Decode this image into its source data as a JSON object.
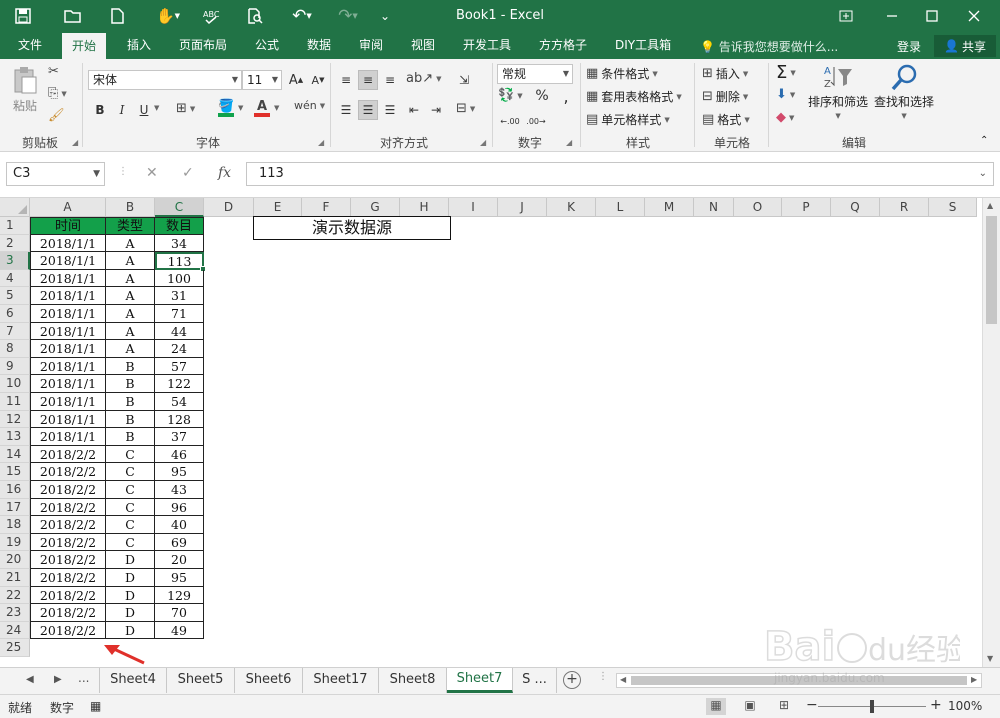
{
  "window": {
    "title": "Book1 - Excel"
  },
  "quick_access": [
    {
      "name": "save-icon",
      "glyph": "💾"
    },
    {
      "name": "open-icon",
      "glyph": "📂"
    },
    {
      "name": "new-icon",
      "glyph": "🗋"
    },
    {
      "name": "touch-mode-icon",
      "glyph": "✋"
    },
    {
      "name": "spellcheck-icon",
      "glyph": "✓"
    },
    {
      "name": "print-preview-icon",
      "glyph": "🔍"
    },
    {
      "name": "undo-icon",
      "glyph": "↶"
    },
    {
      "name": "redo-icon",
      "glyph": "↷"
    },
    {
      "name": "customize-qat-icon",
      "glyph": "⌄"
    }
  ],
  "tabs": [
    {
      "label": "文件"
    },
    {
      "label": "开始"
    },
    {
      "label": "插入"
    },
    {
      "label": "页面布局"
    },
    {
      "label": "公式"
    },
    {
      "label": "数据"
    },
    {
      "label": "审阅"
    },
    {
      "label": "视图"
    },
    {
      "label": "开发工具"
    },
    {
      "label": "方方格子"
    },
    {
      "label": "DIY工具箱"
    }
  ],
  "active_tab": "开始",
  "tell_me": "告诉我您想要做什么...",
  "login": "登录",
  "share": "共享",
  "ribbon": {
    "clipboard": {
      "label": "剪贴板",
      "paste": "粘贴"
    },
    "font": {
      "label": "字体",
      "font_name": "宋体",
      "font_size": "11"
    },
    "alignment": {
      "label": "对齐方式"
    },
    "number": {
      "label": "数字",
      "format": "常规"
    },
    "styles": {
      "label": "样式",
      "conditional": "条件格式",
      "table": "套用表格格式",
      "cell_styles": "单元格样式"
    },
    "cells": {
      "label": "单元格",
      "insert": "插入",
      "delete": "删除",
      "format": "格式"
    },
    "editing": {
      "label": "编辑",
      "sort_filter": "排序和筛选",
      "find_select": "查找和选择"
    }
  },
  "formula_bar": {
    "name_box": "C3",
    "value": "113",
    "fx": "fx"
  },
  "columns": [
    "A",
    "B",
    "C",
    "D",
    "E",
    "F",
    "G",
    "H",
    "I",
    "J",
    "K",
    "L",
    "M",
    "N",
    "O",
    "P",
    "Q",
    "R",
    "S"
  ],
  "selected_column": "C",
  "selected_row": 3,
  "table": {
    "headers": [
      "时间",
      "类型",
      "数目"
    ],
    "rows": [
      [
        "2018/1/1",
        "A",
        "34"
      ],
      [
        "2018/1/1",
        "A",
        "113"
      ],
      [
        "2018/1/1",
        "A",
        "100"
      ],
      [
        "2018/1/1",
        "A",
        "31"
      ],
      [
        "2018/1/1",
        "A",
        "71"
      ],
      [
        "2018/1/1",
        "A",
        "44"
      ],
      [
        "2018/1/1",
        "A",
        "24"
      ],
      [
        "2018/1/1",
        "B",
        "57"
      ],
      [
        "2018/1/1",
        "B",
        "122"
      ],
      [
        "2018/1/1",
        "B",
        "54"
      ],
      [
        "2018/1/1",
        "B",
        "128"
      ],
      [
        "2018/1/1",
        "B",
        "37"
      ],
      [
        "2018/2/2",
        "C",
        "46"
      ],
      [
        "2018/2/2",
        "C",
        "95"
      ],
      [
        "2018/2/2",
        "C",
        "43"
      ],
      [
        "2018/2/2",
        "C",
        "96"
      ],
      [
        "2018/2/2",
        "C",
        "40"
      ],
      [
        "2018/2/2",
        "C",
        "69"
      ],
      [
        "2018/2/2",
        "D",
        "20"
      ],
      [
        "2018/2/2",
        "D",
        "95"
      ],
      [
        "2018/2/2",
        "D",
        "129"
      ],
      [
        "2018/2/2",
        "D",
        "70"
      ],
      [
        "2018/2/2",
        "D",
        "49"
      ]
    ],
    "header_color": "#13a04a"
  },
  "demo_label": "演示数据源",
  "row_numbers": [
    "1",
    "2",
    "3",
    "4",
    "5",
    "6",
    "7",
    "8",
    "9",
    "10",
    "11",
    "12",
    "13",
    "14",
    "15",
    "16",
    "17",
    "18",
    "19",
    "20",
    "21",
    "22",
    "23",
    "24",
    "25"
  ],
  "sheets": {
    "ellipsis_left": "...",
    "tabs": [
      "Sheet4",
      "Sheet5",
      "Sheet6",
      "Sheet17",
      "Sheet8",
      "Sheet7",
      "S ..."
    ],
    "active": "Sheet7"
  },
  "status": {
    "ready": "就绪",
    "num": "数字",
    "zoom": "100%",
    "minus": "−",
    "plus": "+"
  },
  "watermark": {
    "text": "Baidu经验",
    "url_text": "jingyan.baidu.com"
  },
  "colors": {
    "excel_green": "#217346",
    "arrow_red": "#e0302a"
  }
}
